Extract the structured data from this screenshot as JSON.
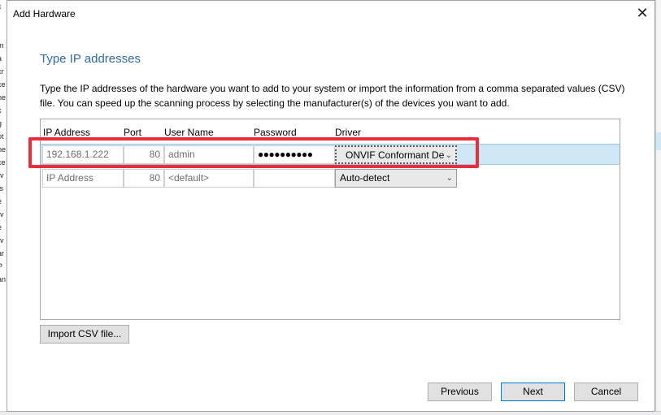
{
  "dialog": {
    "title": "Add Hardware",
    "close_label": "✕",
    "heading": "Type IP addresses",
    "description": "Type the IP addresses of the hardware you want to add to your system or import the information from a comma separated values (CSV) file. You can speed up the scanning process by selecting the manufacturer(s) of the devices you want to add."
  },
  "table": {
    "columns": [
      "IP Address",
      "Port",
      "User Name",
      "Password",
      "Driver"
    ],
    "rows": [
      {
        "ip": "192.168.1.222",
        "port": "80",
        "user": "admin",
        "password": "●●●●●●●●●●",
        "driver": "ONVIF Conformant De"
      },
      {
        "ip": "IP Address",
        "port": "80",
        "user": "<default>",
        "password": "",
        "driver": "Auto-detect"
      }
    ]
  },
  "buttons": {
    "import": "Import CSV file...",
    "previous": "Previous",
    "next": "Next",
    "cancel": "Cancel"
  },
  "background_left_text": [
    "c",
    "r",
    "",
    "l",
    "m",
    "a",
    "cr",
    "ce",
    "ne",
    "x",
    "g",
    "ot",
    "ne",
    "ce",
    "rv",
    "ts",
    "e",
    "rv",
    "e",
    "rv",
    "ar",
    "P",
    "an"
  ],
  "colors": {
    "heading": "#2f6da3",
    "selected_row": "#cfe6f7",
    "highlight": "#ea2c3b",
    "primary_border": "#0078d7"
  }
}
